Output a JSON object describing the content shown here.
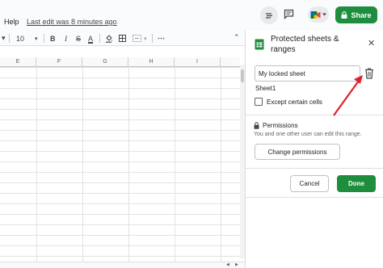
{
  "header": {
    "menu_help": "Help",
    "last_edit": "Last edit was 8 minutes ago",
    "share_label": "Share"
  },
  "toolbar": {
    "font_size": "10",
    "bold": "B",
    "italic": "I",
    "strikethrough": "S",
    "text_color": "A",
    "more": "⋯"
  },
  "grid": {
    "columns": [
      "E",
      "F",
      "G",
      "H",
      "I"
    ]
  },
  "panel": {
    "title": "Protected sheets & ranges",
    "description_input_value": "My locked sheet",
    "range": "Sheet1",
    "except_label": "Except certain cells",
    "except_checked": false,
    "permissions_title": "Permissions",
    "permissions_desc": "You and one other user can edit this range.",
    "change_permissions_label": "Change permissions",
    "cancel_label": "Cancel",
    "done_label": "Done"
  },
  "colors": {
    "accent_green": "#1e8e3e",
    "arrow_red": "#e0202c"
  }
}
